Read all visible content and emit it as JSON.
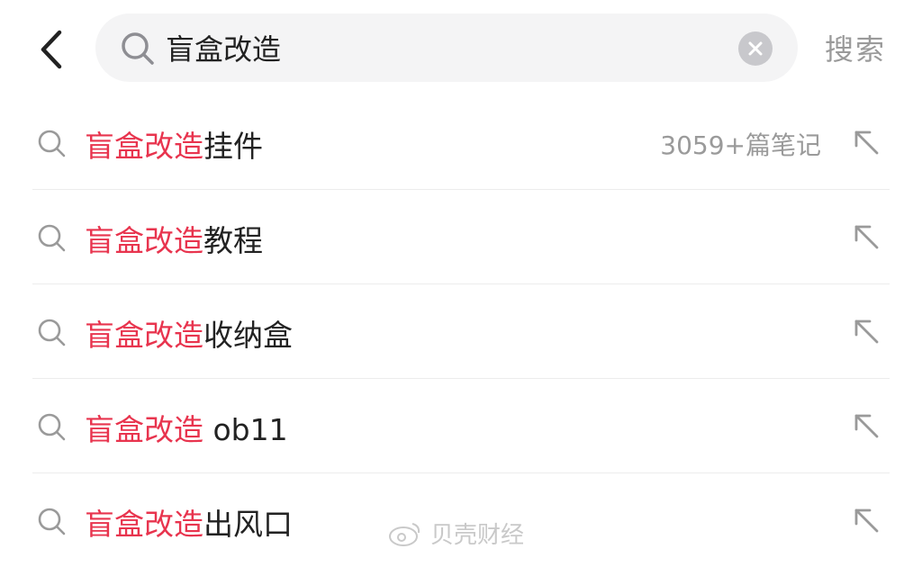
{
  "search": {
    "query": "盲盒改造",
    "submit_label": "搜索"
  },
  "suggestions": [
    {
      "highlight": "盲盒改造",
      "suffix": "挂件",
      "count": "3059+篇笔记"
    },
    {
      "highlight": "盲盒改造",
      "suffix": "教程",
      "count": ""
    },
    {
      "highlight": "盲盒改造",
      "suffix": "收纳盒",
      "count": ""
    },
    {
      "highlight": "盲盒改造",
      "suffix": " ob11",
      "count": ""
    },
    {
      "highlight": "盲盒改造",
      "suffix": "出风口",
      "count": ""
    }
  ],
  "watermark": "贝壳财经",
  "colors": {
    "highlight": "#e8344e",
    "muted": "#9a9a9a"
  },
  "icons": [
    "back-chevron-icon",
    "search-icon",
    "clear-icon",
    "fill-arrow-icon"
  ]
}
